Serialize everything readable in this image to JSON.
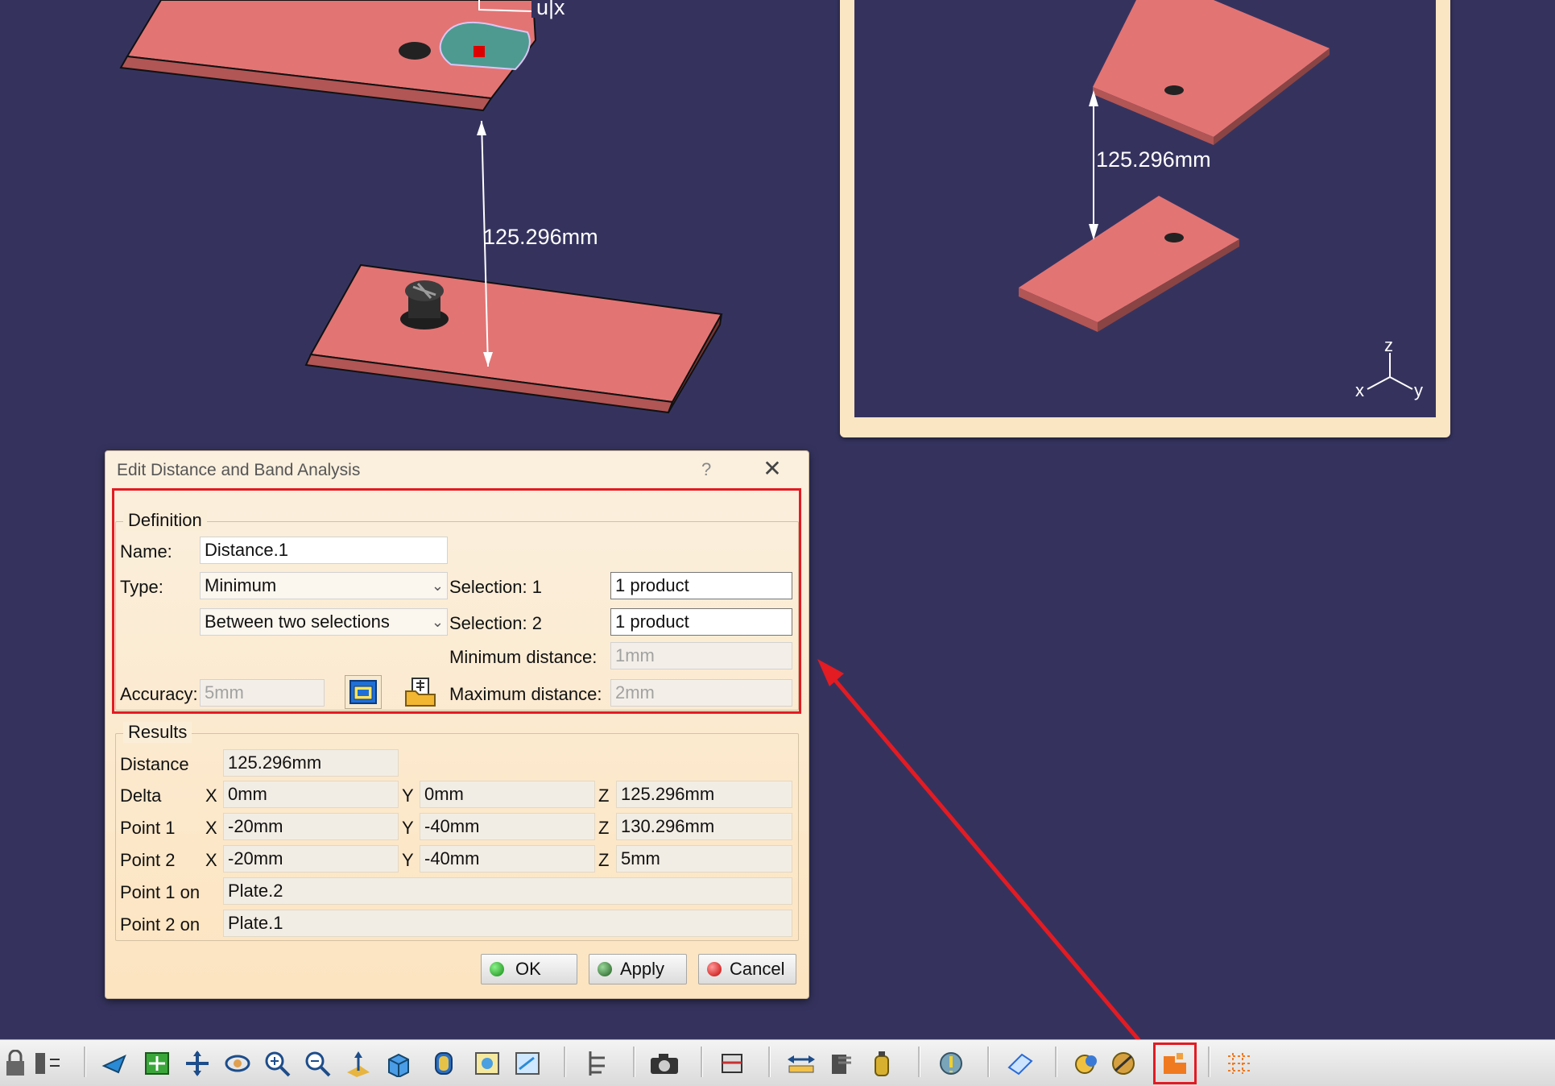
{
  "viewport": {
    "main_distance_label": "125.296mm",
    "partial_label": "u|x",
    "inset_distance_label": "125.296mm",
    "axes": {
      "z": "z",
      "x": "x",
      "y": "y"
    }
  },
  "dialog": {
    "title": "Edit Distance and Band Analysis",
    "help": "?",
    "close": "✕",
    "definition": {
      "legend": "Definition",
      "name_label": "Name:",
      "name_value": "Distance.1",
      "type_label": "Type:",
      "type_value": "Minimum",
      "mode_value": "Between two selections",
      "selection1_label": "Selection: 1",
      "selection1_value": "1 product",
      "selection2_label": "Selection: 2",
      "selection2_value": "1 product",
      "min_distance_label": "Minimum distance:",
      "min_distance_value": "1mm",
      "accuracy_label": "Accuracy:",
      "accuracy_value": "5mm",
      "max_distance_label": "Maximum distance:",
      "max_distance_value": "2mm"
    },
    "results": {
      "legend": "Results",
      "distance_label": "Distance",
      "distance_value": "125.296mm",
      "rows": [
        {
          "label": "Delta",
          "x": "0mm",
          "y": "0mm",
          "z": "125.296mm"
        },
        {
          "label": "Point 1",
          "x": "-20mm",
          "y": "-40mm",
          "z": "130.296mm"
        },
        {
          "label": "Point 2",
          "x": "-20mm",
          "y": "-40mm",
          "z": "5mm"
        }
      ],
      "axis_x": "X",
      "axis_y": "Y",
      "axis_z": "Z",
      "point1_on_label": "Point 1 on",
      "point1_on_value": "Plate.2",
      "point2_on_label": "Point 2 on",
      "point2_on_value": "Plate.1"
    },
    "buttons": {
      "ok": "OK",
      "apply": "Apply",
      "cancel": "Cancel"
    }
  },
  "colors": {
    "viewport_bg": "#35335e",
    "plate": "#e37474",
    "highlight": "#e31b23",
    "dialog_bg": "#fce4c0"
  }
}
